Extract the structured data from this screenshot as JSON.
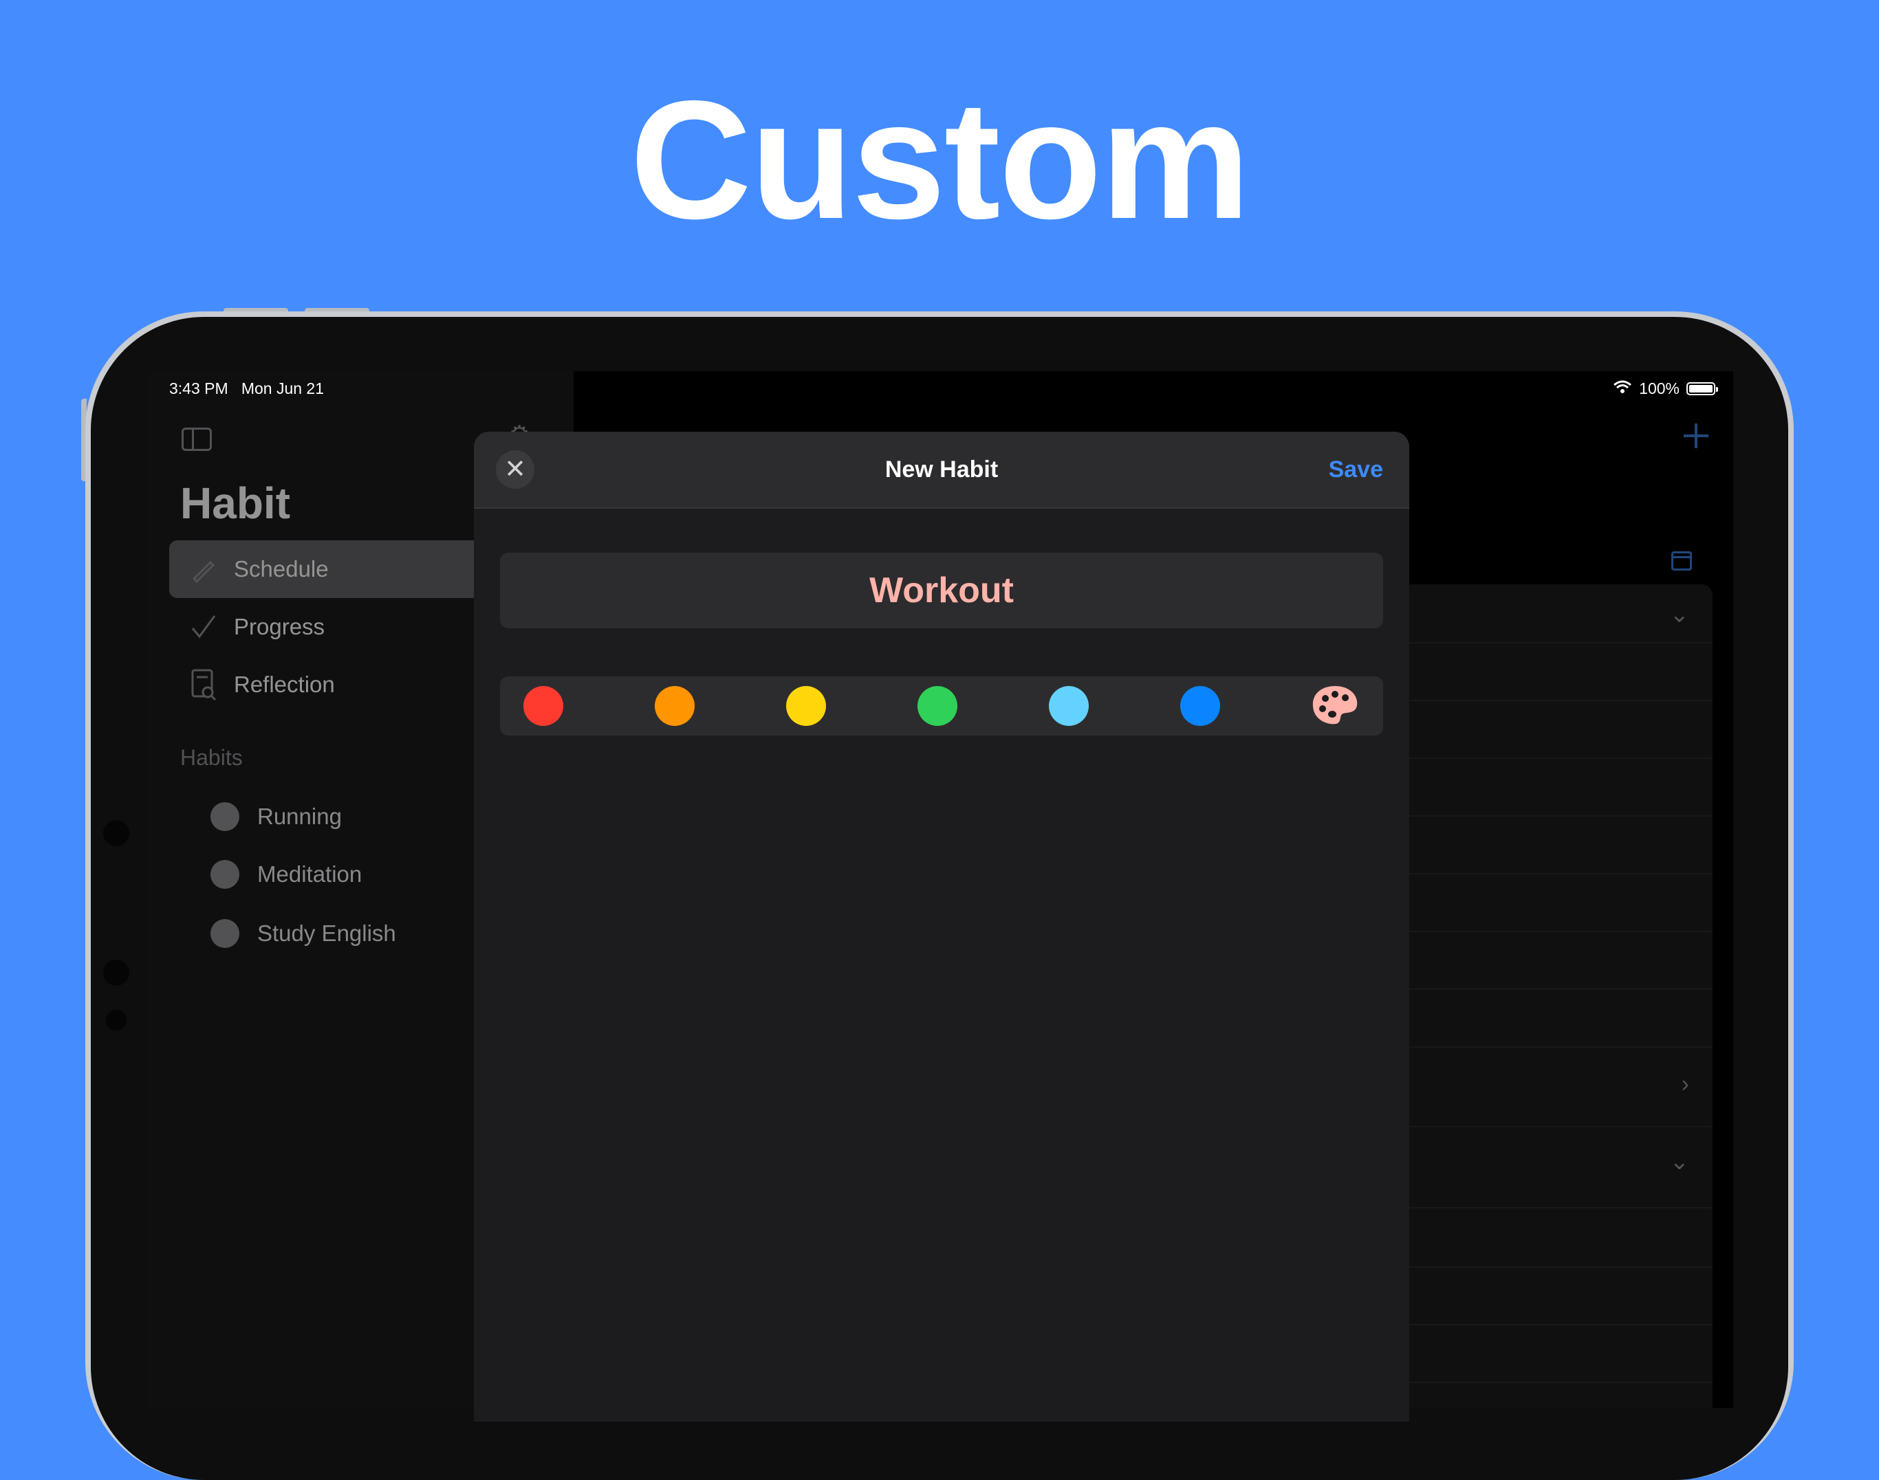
{
  "headline": "Custom",
  "status": {
    "time": "3:43 PM",
    "date": "Mon Jun 21",
    "battery": "100%"
  },
  "sidebar": {
    "title": "Habit",
    "nav": [
      {
        "label": "Schedule",
        "icon": "pencil-icon",
        "selected": true
      },
      {
        "label": "Progress",
        "icon": "checkmark-icon",
        "selected": false
      },
      {
        "label": "Reflection",
        "icon": "document-search-icon",
        "selected": false
      }
    ],
    "habits_label": "Habits",
    "habits": [
      {
        "label": "Running"
      },
      {
        "label": "Meditation"
      },
      {
        "label": "Study English"
      }
    ]
  },
  "modal": {
    "title": "New Habit",
    "save_label": "Save",
    "close_icon": "xmark-icon",
    "name_value": "Workout",
    "name_color": "#ffb3aa",
    "colors": [
      {
        "name": "red",
        "hex": "#ff3b30"
      },
      {
        "name": "orange",
        "hex": "#ff9500"
      },
      {
        "name": "yellow",
        "hex": "#ffd60a"
      },
      {
        "name": "green",
        "hex": "#30d158"
      },
      {
        "name": "cyan",
        "hex": "#64d2ff"
      },
      {
        "name": "blue",
        "hex": "#0a84ff"
      }
    ],
    "custom_color_icon": "palette-icon"
  },
  "theme": {
    "background": "#448cff",
    "accent": "#3d8af7"
  }
}
